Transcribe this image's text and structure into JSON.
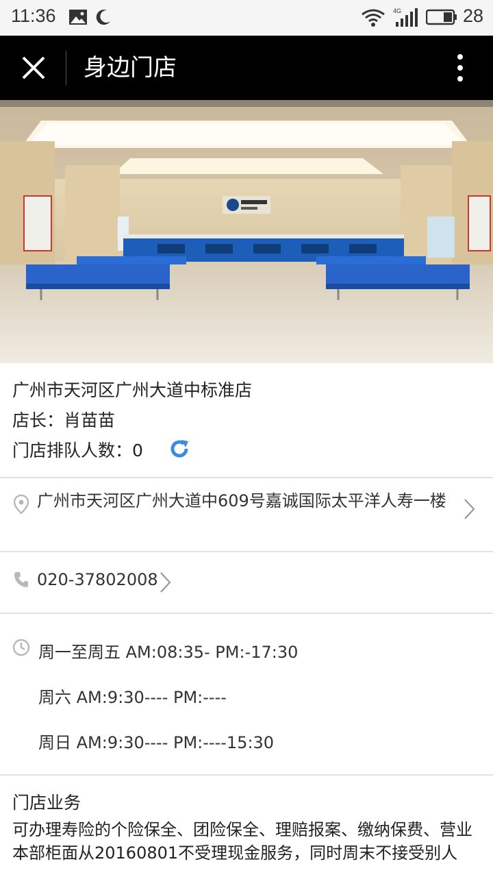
{
  "status_bar": {
    "time": "11:36",
    "battery": "28",
    "icons": [
      "image-icon",
      "moon-icon",
      "wifi-icon",
      "signal-4g-icon",
      "battery-icon"
    ]
  },
  "title_bar": {
    "title": "身边门店",
    "left_icon": "close-icon",
    "right_icon": "more-vertical-icon"
  },
  "store": {
    "name": "广州市天河区广州大道中标准店",
    "manager": "店长：肖苗苗",
    "queue_label": "门店排队人数：0",
    "refresh_icon": "refresh-icon",
    "accent_color": "#3c8be0"
  },
  "address": {
    "icon": "location-pin-icon",
    "text": "广州市天河区广州大道中609号嘉诚国际太平洋人寿一楼"
  },
  "phone": {
    "icon": "phone-icon",
    "number": "020-37802008"
  },
  "hours": {
    "icon": "clock-icon",
    "lines": [
      "周一至周五 AM:08:35- PM:-17:30",
      "周六 AM:9:30---- PM:----",
      "周日 AM:9:30---- PM:----15:30"
    ]
  },
  "business": {
    "title": "门店业务",
    "text": "可办理寿险的个险保全、团险保全、理赔报案、缴纳保费、营业本部柜面从20160801不受理现金服务，同时周末不接受别人"
  }
}
